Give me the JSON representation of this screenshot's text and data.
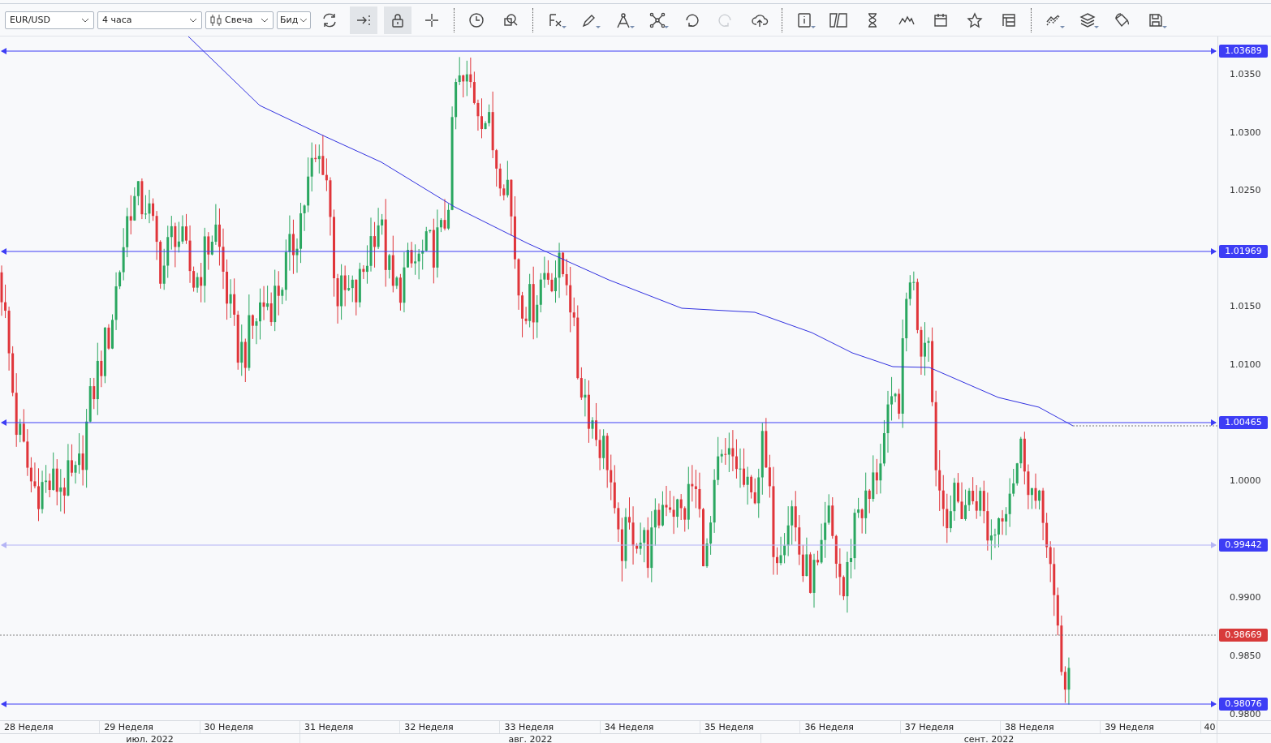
{
  "toolbar": {
    "selects": [
      {
        "kind": "symbol",
        "value": "EUR/USD"
      },
      {
        "kind": "timeframe",
        "value": "4 часа"
      },
      {
        "kind": "charttype",
        "value": "Свеча"
      },
      {
        "kind": "price",
        "value": "Бид"
      }
    ],
    "groups": [
      [
        {
          "kind": "refresh",
          "on": false,
          "disabled": false
        },
        {
          "kind": "scroll-end",
          "on": true,
          "disabled": false
        },
        {
          "kind": "lock",
          "on": true,
          "disabled": false
        },
        {
          "kind": "crosshair",
          "on": false,
          "disabled": false
        }
      ],
      [
        {
          "kind": "clock",
          "on": false,
          "disabled": false
        },
        {
          "kind": "zoom",
          "on": false,
          "disabled": false
        }
      ],
      [
        {
          "kind": "fx",
          "on": false,
          "disabled": false
        },
        {
          "kind": "pencil",
          "on": false,
          "disabled": false
        },
        {
          "kind": "compass",
          "on": false,
          "disabled": false
        },
        {
          "kind": "nodes",
          "on": false,
          "disabled": false
        },
        {
          "kind": "undo",
          "on": false,
          "disabled": false
        },
        {
          "kind": "redo",
          "on": false,
          "disabled": true
        },
        {
          "kind": "upload",
          "on": false,
          "disabled": false
        }
      ],
      [
        {
          "kind": "info",
          "on": false,
          "disabled": false
        },
        {
          "kind": "shapes",
          "on": false,
          "disabled": false
        },
        {
          "kind": "hourglass",
          "on": false,
          "disabled": false
        },
        {
          "kind": "zigzag",
          "on": false,
          "disabled": false
        },
        {
          "kind": "calendar",
          "on": false,
          "disabled": false
        },
        {
          "kind": "star",
          "on": false,
          "disabled": false
        },
        {
          "kind": "tree",
          "on": false,
          "disabled": false
        }
      ],
      [
        {
          "kind": "trend",
          "on": false,
          "disabled": false
        },
        {
          "kind": "layers",
          "on": false,
          "disabled": false
        },
        {
          "kind": "bucket",
          "on": false,
          "disabled": false
        },
        {
          "kind": "save",
          "on": false,
          "disabled": false
        }
      ]
    ]
  },
  "price_axis": {
    "ticks": [
      "1.0350",
      "1.0300",
      "1.0250",
      "1.0150",
      "1.0100",
      "1.0000",
      "0.9900",
      "0.9850",
      "0.9800"
    ],
    "tags": [
      {
        "label": "1.03689",
        "kind": "level"
      },
      {
        "label": "1.01969",
        "kind": "level"
      },
      {
        "label": "1.00465",
        "kind": "level"
      },
      {
        "label": "0.99442",
        "kind": "level-faint"
      },
      {
        "label": "0.98669",
        "kind": "current"
      },
      {
        "label": "0.98076",
        "kind": "level"
      }
    ]
  },
  "time_axis": {
    "weeks": [
      "28 Неделя",
      "29 Неделя",
      "30 Неделя",
      "31 Неделя",
      "32 Неделя",
      "33 Неделя",
      "34 Неделя",
      "35 Неделя",
      "36 Неделя",
      "37 Неделя",
      "38 Неделя",
      "39 Неделя",
      "40"
    ],
    "months": [
      "июл. 2022",
      "авг. 2022",
      "сент. 2022"
    ]
  }
}
